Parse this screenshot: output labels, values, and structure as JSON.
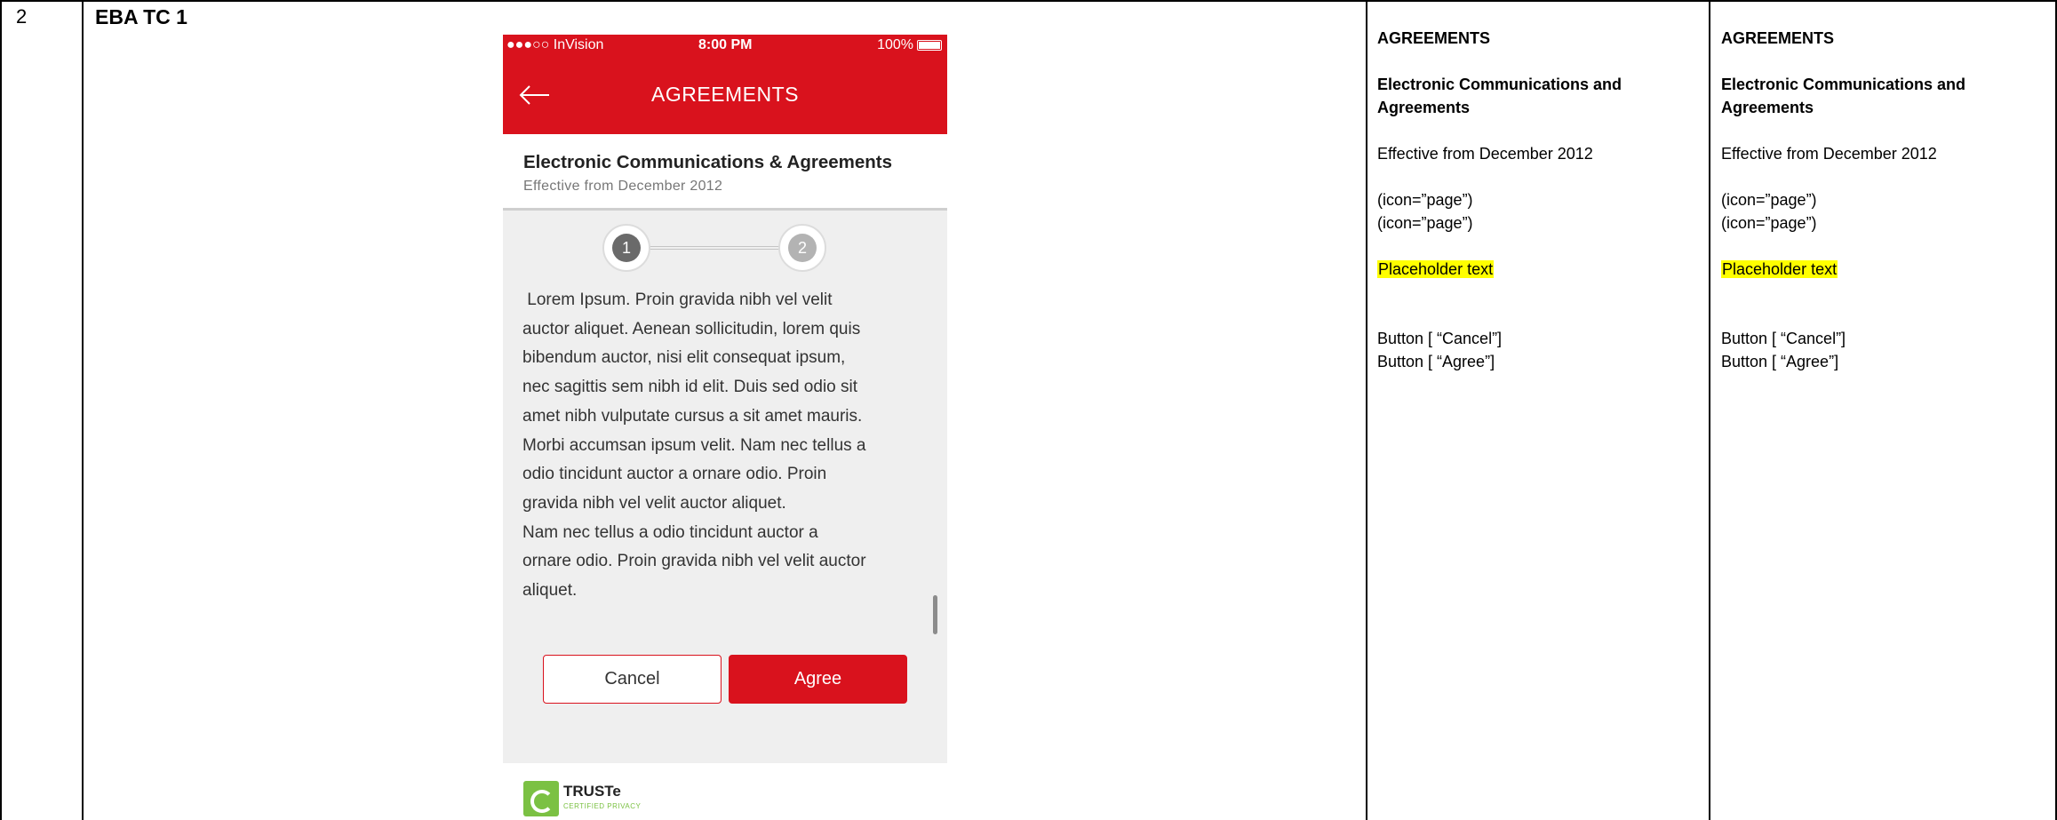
{
  "row": {
    "number": "2",
    "test_id": "EBA TC 1"
  },
  "phone": {
    "status_bar": {
      "carrier": "●●●○○ InVision",
      "time": "8:00 PM",
      "battery": "100%"
    },
    "nav": {
      "title": "AGREEMENTS",
      "back_icon": "back-arrow-icon"
    },
    "header": {
      "title": "Electronic Communications & Agreements",
      "subtitle": "Effective from December 2012"
    },
    "stepper": {
      "steps": [
        "1",
        "2"
      ],
      "current": 1
    },
    "body": " Lorem Ipsum. Proin gravida nibh vel velit\nauctor aliquet. Aenean sollicitudin, lorem quis\nbibendum auctor, nisi elit consequat ipsum,\nnec sagittis sem nibh id elit. Duis sed odio sit\namet nibh vulputate cursus a sit amet mauris.\nMorbi accumsan ipsum velit. Nam nec tellus a\nodio tincidunt auctor a ornare odio. Proin\ngravida nibh vel velit auctor aliquet.\nNam nec tellus a odio tincidunt auctor a\nornare odio. Proin gravida nibh vel velit auctor\naliquet.",
    "buttons": {
      "cancel": "Cancel",
      "agree": "Agree"
    },
    "footer": {
      "seal_name": "TRUSTe",
      "seal_sub": "CERTIFIED PRIVACY"
    }
  },
  "spec_columns": [
    {
      "heading": "AGREEMENTS",
      "title": "Electronic Communications and Agreements",
      "effective": "Effective from December 2012",
      "icon_line_1": "(icon=”page”)",
      "icon_line_2": "(icon=”page”)",
      "placeholder": "Placeholder text",
      "button_1": "Button [ “Cancel”]",
      "button_2": "Button [ “Agree”]"
    },
    {
      "heading": "AGREEMENTS",
      "title": "Electronic Communications and Agreements",
      "effective": "Effective from December 2012",
      "icon_line_1": "(icon=”page”)",
      "icon_line_2": "(icon=”page”)",
      "placeholder": "Placeholder text",
      "button_1": "Button [ “Cancel”]",
      "button_2": "Button [ “Agree”]"
    }
  ],
  "colors": {
    "brand_red": "#d9121d",
    "highlight": "#ffff00",
    "truste_green": "#7bc143"
  }
}
